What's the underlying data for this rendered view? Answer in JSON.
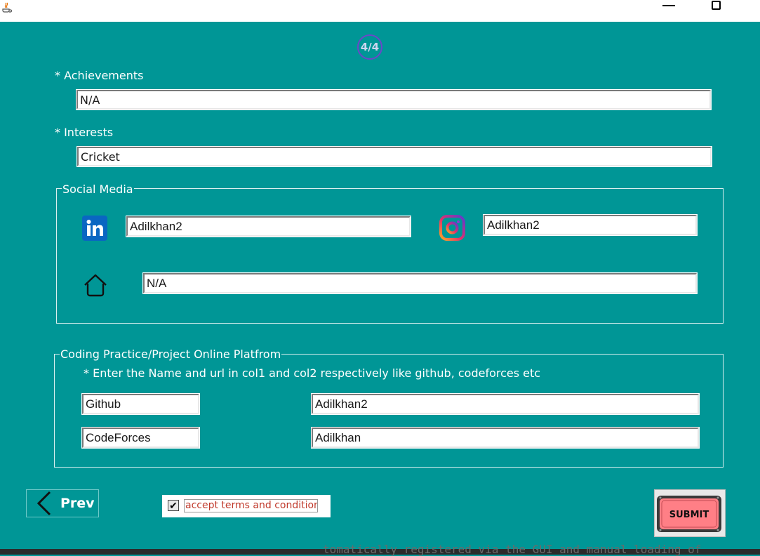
{
  "window": {
    "minimize_icon": "minimize-icon",
    "maximize_icon": "maximize-icon",
    "app_icon": "java-icon"
  },
  "step_indicator": "4/4",
  "achievements": {
    "label": "* Achievements",
    "value": "N/A"
  },
  "interests": {
    "label": "* Interests",
    "value": "Cricket"
  },
  "social_media": {
    "title": "Social Media",
    "linkedin": {
      "icon": "linkedin-icon",
      "value": "Adilkhan2"
    },
    "instagram": {
      "icon": "instagram-icon",
      "value": "Adilkhan2"
    },
    "website": {
      "icon": "home-icon",
      "value": "N/A"
    }
  },
  "coding": {
    "title": "Coding Practice/Project Online Platfrom",
    "hint": "* Enter the Name and url in col1 and col2 respectively like github, codeforces etc",
    "rows": [
      {
        "name": "Github",
        "url": "Adilkhan2"
      },
      {
        "name": "CodeForces",
        "url": "Adilkhan"
      }
    ]
  },
  "footer": {
    "prev_label": "Prev",
    "terms_label": "accept terms and conditions",
    "terms_checked": true,
    "submit_label": "SUBMIT"
  },
  "background_text": "tomatically registered via the GUI and manual loading of"
}
